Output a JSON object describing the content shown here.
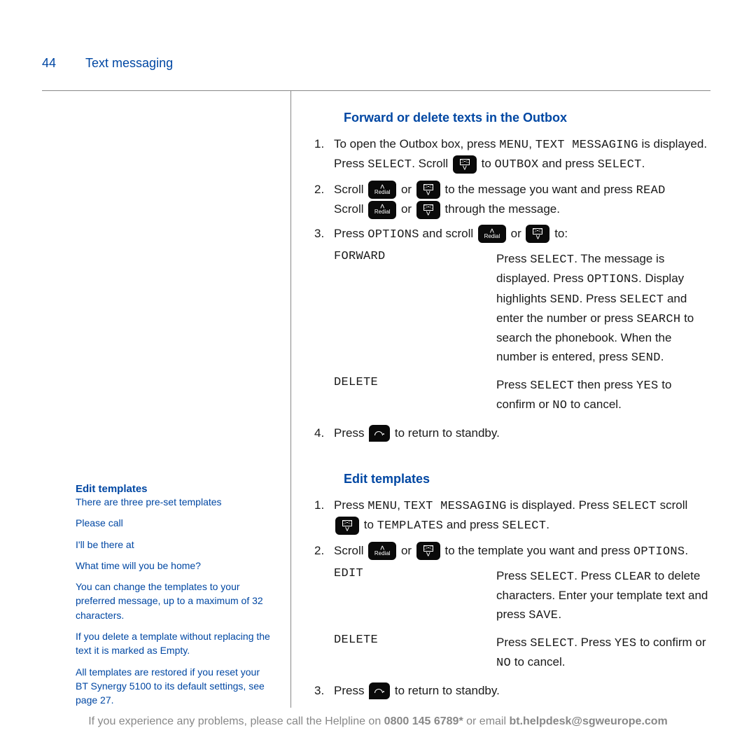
{
  "page_number": "44",
  "page_title": "Text messaging",
  "section1": {
    "heading": "Forward or delete texts in the Outbox",
    "step1_a": "To open the Outbox box, press ",
    "step1_menu": "MENU",
    "step1_b": ", ",
    "step1_tm": "TEXT MESSAGING",
    "step1_c": " is displayed. Press ",
    "step1_select": "SELECT",
    "step1_d": ". Scroll ",
    "step1_e": " to ",
    "step1_outbox": "OUTBOX",
    "step1_f": " and press ",
    "step1_g": ".",
    "step2_a": "Scroll ",
    "step2_or": " or ",
    "step2_b": " to the message you want and press ",
    "step2_read": "READ",
    "step2_c": "Scroll ",
    "step2_d": " through the message.",
    "step3_a": "Press ",
    "step3_opts": "OPTIONS",
    "step3_b": " and scroll ",
    "step3_c": " to:",
    "forward_label": "FORWARD",
    "forward_a": "Press ",
    "forward_b": ". The message is displayed. Press ",
    "forward_c": ". Display highlights ",
    "forward_send": "SEND",
    "forward_d": ". Press ",
    "forward_e": " and enter the number or press ",
    "forward_search": "SEARCH",
    "forward_f": " to search the phonebook. When the number is entered, press ",
    "forward_g": ".",
    "delete_label": "DELETE",
    "delete_a": "Press ",
    "delete_b": " then press ",
    "delete_yes": "YES",
    "delete_c": " to confirm or ",
    "delete_no": "NO",
    "delete_d": " to cancel.",
    "step4_a": "Press ",
    "step4_b": " to return to standby."
  },
  "section2": {
    "heading": "Edit templates",
    "step1_a": "Press ",
    "step1_menu": "MENU",
    "step1_b": ", ",
    "step1_tm": "TEXT MESSAGING",
    "step1_c": " is displayed. Press ",
    "step1_select": "SELECT",
    "step1_d": " scroll ",
    "step1_e": " to ",
    "step1_templates": "TEMPLATES",
    "step1_f": " and press ",
    "step1_g": ".",
    "step2_a": "Scroll ",
    "step2_or": " or ",
    "step2_b": " to the template you want and press ",
    "step2_opts": "OPTIONS",
    "step2_c": ".",
    "edit_label": "EDIT",
    "edit_a": "Press ",
    "edit_b": ". Press ",
    "edit_clear": "CLEAR",
    "edit_c": " to delete characters. Enter your template text and press ",
    "edit_save": "SAVE",
    "edit_d": ".",
    "delete_label": "DELETE",
    "delete_a": "Press ",
    "delete_b": ". Press ",
    "delete_yes": "YES",
    "delete_c": " to confirm or ",
    "delete_no": "NO",
    "delete_d": " to cancel.",
    "step3_a": "Press ",
    "step3_b": " to return to standby."
  },
  "sidebar": {
    "heading": "Edit templates",
    "intro": "There are three pre-set templates",
    "t1": "Please call",
    "t2": "I'll be there at",
    "t3": "What time will you be home?",
    "p1": "You can change the templates to your preferred message, up to a maximum of 32 characters.",
    "p2": "If you delete a template without replacing the text it is marked as Empty.",
    "p3": "All templates are restored if you reset your BT Synergy 5100 to its default settings, see page 27."
  },
  "footer": {
    "a": "If you experience any problems, please call the Helpline on ",
    "phone": "0800 145 6789*",
    "b": " or email ",
    "email": "bt.helpdesk@sgweurope.com"
  },
  "nums": {
    "n1": "1.",
    "n2": "2.",
    "n3": "3.",
    "n4": "4."
  }
}
